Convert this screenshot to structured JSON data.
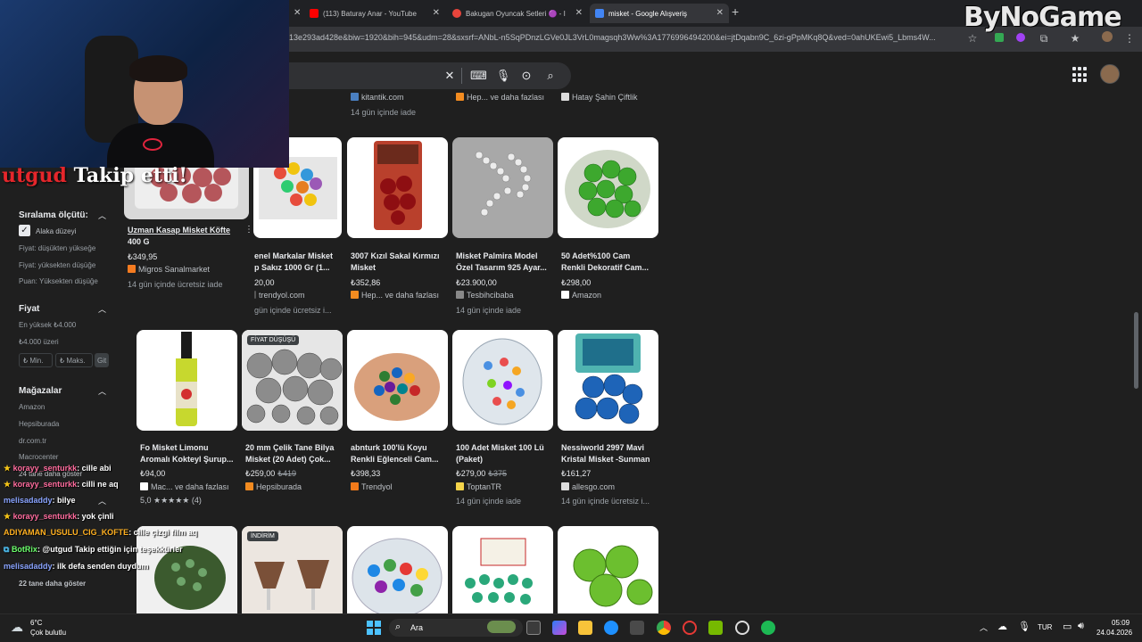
{
  "browser": {
    "tabs": [
      {
        "title": "(113) Baturay Anar - YouTube",
        "color": "#ff0000"
      },
      {
        "title": "Bakugan Oyuncak Setleri 🟣 - I",
        "color": "#e8453c"
      },
      {
        "title": "misket - Google Alışveriş",
        "color": "#4285f4"
      }
    ],
    "new_tab": "+",
    "url": "13e293ad428e&biw=1920&bih=945&udm=28&sxsrf=ANbL-n5SqPDnzLGVe0JL3VrL0magsqh3Ww%3A1776996494200&ei=jtDqabn9C_6zi-gPpMKq8Q&ved=0ahUKEwi5_Lbms4W..."
  },
  "watermark": "ByNoGame",
  "follow_alert": {
    "user": "utgud",
    "text": "Takip etti!"
  },
  "top_row": [
    {
      "store": "kitantik.com",
      "ship": "14 gün içinde iade"
    },
    {
      "store": "Hep... ve daha fazlası"
    },
    {
      "store": "Hatay Şahin Çiftlik"
    }
  ],
  "sidebar": {
    "sort": {
      "heading": "Sıralama ölçütü:",
      "items": [
        "Alaka düzeyi",
        "Fiyat: düşükten yükseğe",
        "Fiyat: yüksekten düşüğe",
        "Puan: Yüksekten düşüğe"
      ]
    },
    "price": {
      "heading": "Fiyat",
      "items": [
        "En yüksek ₺4.000",
        "₺4.000 üzeri"
      ],
      "min_placeholder": "₺ Min.",
      "max_placeholder": "₺ Maks.",
      "go": "Git"
    },
    "stores": {
      "heading": "Mağazalar",
      "items": [
        "Amazon",
        "Hepsiburada",
        "dr.com.tr",
        "Macrocenter"
      ],
      "more": "24 tane daha göster"
    },
    "more2": "22 tane daha göster"
  },
  "row1": [
    {
      "title": "Uzman Kasap Misket Köfte",
      "title2": "400 G",
      "price": "₺349,95",
      "store": "Migros Sanalmarket",
      "store_color": "#f47b20",
      "ship": "14 gün içinde ücretsiz iade"
    },
    {
      "title": "enel Markalar Misket",
      "title2": "p Sakız 1000 Gr (1...",
      "price": "20,00",
      "store": "trendyol.com",
      "store_color": "#555555",
      "ship": "gün içinde ücretsiz i..."
    },
    {
      "title": "3007 Kızıl Sakal Kırmızı",
      "title2": "Misket",
      "price": "₺352,86",
      "store": "Hep... ve daha fazlası",
      "store_color": "#f28b20",
      "ship": ""
    },
    {
      "title": "Misket Palmira Model",
      "title2": "Özel Tasarım 925 Ayar...",
      "price": "₺23.900,00",
      "store": "Tesbihcibaba",
      "store_color": "#888888",
      "ship": "14 gün içinde iade"
    },
    {
      "title": "50 Adet%100 Cam",
      "title2": "Renkli Dekoratif Cam...",
      "price": "₺298,00",
      "store": "Amazon",
      "store_color": "#ffffff",
      "ship": ""
    }
  ],
  "row2": [
    {
      "title": "Fo Misket Limonu",
      "title2": "Aromalı Kokteyl Şurup...",
      "price": "₺94,00",
      "old": "",
      "store": "Mac... ve daha fazlası",
      "store_color": "#ffffff",
      "rating": "5,0 ★★★★★ (4)",
      "ship": "",
      "badge": ""
    },
    {
      "title": "20 mm Çelik Tane Bilya",
      "title2": "Misket (20 Adet) Çok...",
      "price": "₺259,00",
      "old": "₺419",
      "store": "Hepsiburada",
      "store_color": "#f28b20",
      "rating": "",
      "ship": "",
      "badge": "FİYAT DÜŞÜŞÜ"
    },
    {
      "title": "abnturk 100'lü Koyu",
      "title2": "Renkli Eğlenceli Cam...",
      "price": "₺398,33",
      "old": "",
      "store": "Trendyol",
      "store_color": "#f27a1a",
      "rating": "",
      "ship": "",
      "badge": ""
    },
    {
      "title": "100 Adet Misket 100 Lü",
      "title2": "(Paket)",
      "price": "₺279,00",
      "old": "₺375",
      "store": "ToptanTR",
      "store_color": "#f5d44a",
      "rating": "",
      "ship": "14 gün içinde iade",
      "badge": ""
    },
    {
      "title": "Nessiworld 2997 Mavi",
      "title2": "Kristal Misket -Sunman",
      "price": "₺161,27",
      "old": "",
      "store": "allesgo.com",
      "store_color": "#dddddd",
      "rating": "",
      "ship": "14 gün içinde ücretsiz i...",
      "badge": ""
    }
  ],
  "row3_badge": "İNDİRİM",
  "chat": [
    {
      "user": "korayy_senturkk",
      "msg": ": cille abi",
      "color": "#ff6b9d"
    },
    {
      "user": "korayy_senturkk",
      "msg": ": cilli ne aq",
      "color": "#ff6b9d"
    },
    {
      "user": "melisadaddy",
      "msg": ": bilye",
      "color": "#8aa4ff"
    },
    {
      "user": "korayy_senturkk",
      "msg": ": yok çinli",
      "color": "#ff6b9d"
    },
    {
      "user": "ADIYAMAN_USULU_CIG_KOFTE",
      "msg": ": cille çizgi film aq",
      "color": "#ffb020"
    },
    {
      "user": "BotRix",
      "msg": ": @utgud Takip ettiğin için teşekkürler",
      "color": "#6bff6b"
    },
    {
      "user": "melisadaddy",
      "msg": ": ilk defa senden duydum",
      "color": "#8aa4ff"
    }
  ],
  "taskbar": {
    "weather_temp": "6°C",
    "weather_desc": "Çok bulutlu",
    "search": "Ara",
    "lang": "TUR",
    "time": "05:09",
    "date": "24.04.2026"
  }
}
